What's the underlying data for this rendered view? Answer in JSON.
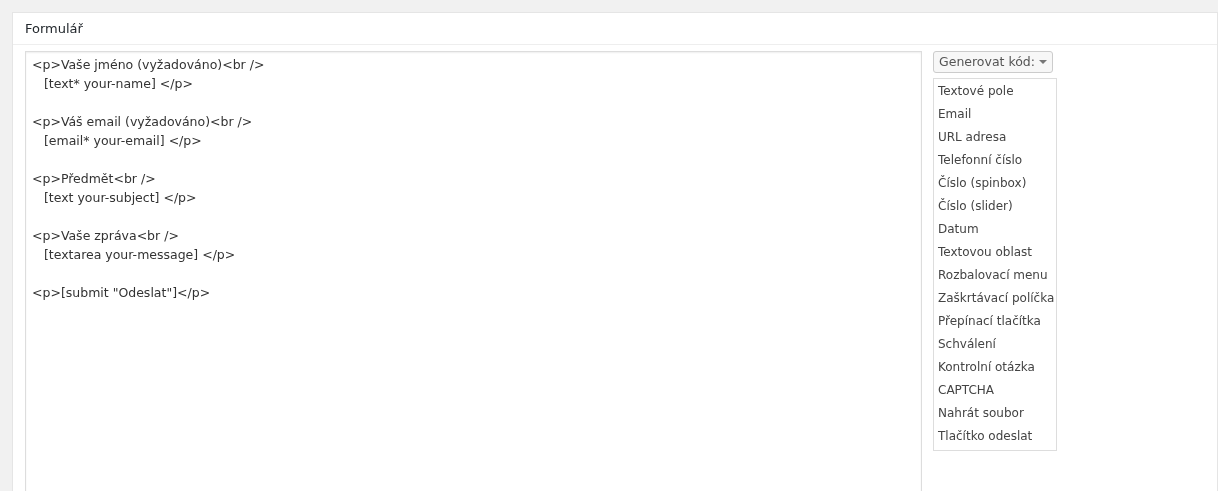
{
  "panel": {
    "title": "Formulář"
  },
  "editor": {
    "blocks": [
      [
        "<p>Vaše jméno (vyžadováno)<br />",
        "   [text* your-name] </p>"
      ],
      [
        "<p>Váš email (vyžadováno)<br />",
        "   [email* your-email] </p>"
      ],
      [
        "<p>Předmět<br />",
        "   [text your-subject] </p>"
      ],
      [
        "<p>Vaše zpráva<br />",
        "   [textarea your-message] </p>"
      ],
      [
        "<p>[submit \"Odeslat\"]</p>"
      ]
    ]
  },
  "generator": {
    "button": "Generovat kód:",
    "items": [
      "Textové pole",
      "Email",
      "URL adresa",
      "Telefonní číslo",
      "Číslo (spinbox)",
      "Číslo (slider)",
      "Datum",
      "Textovou oblast",
      "Rozbalovací menu",
      "Zaškrtávací políčka",
      "Přepínací tlačítka",
      "Schválení",
      "Kontrolní otázka",
      "CAPTCHA",
      "Nahrát soubor",
      "Tlačítko odeslat"
    ]
  }
}
